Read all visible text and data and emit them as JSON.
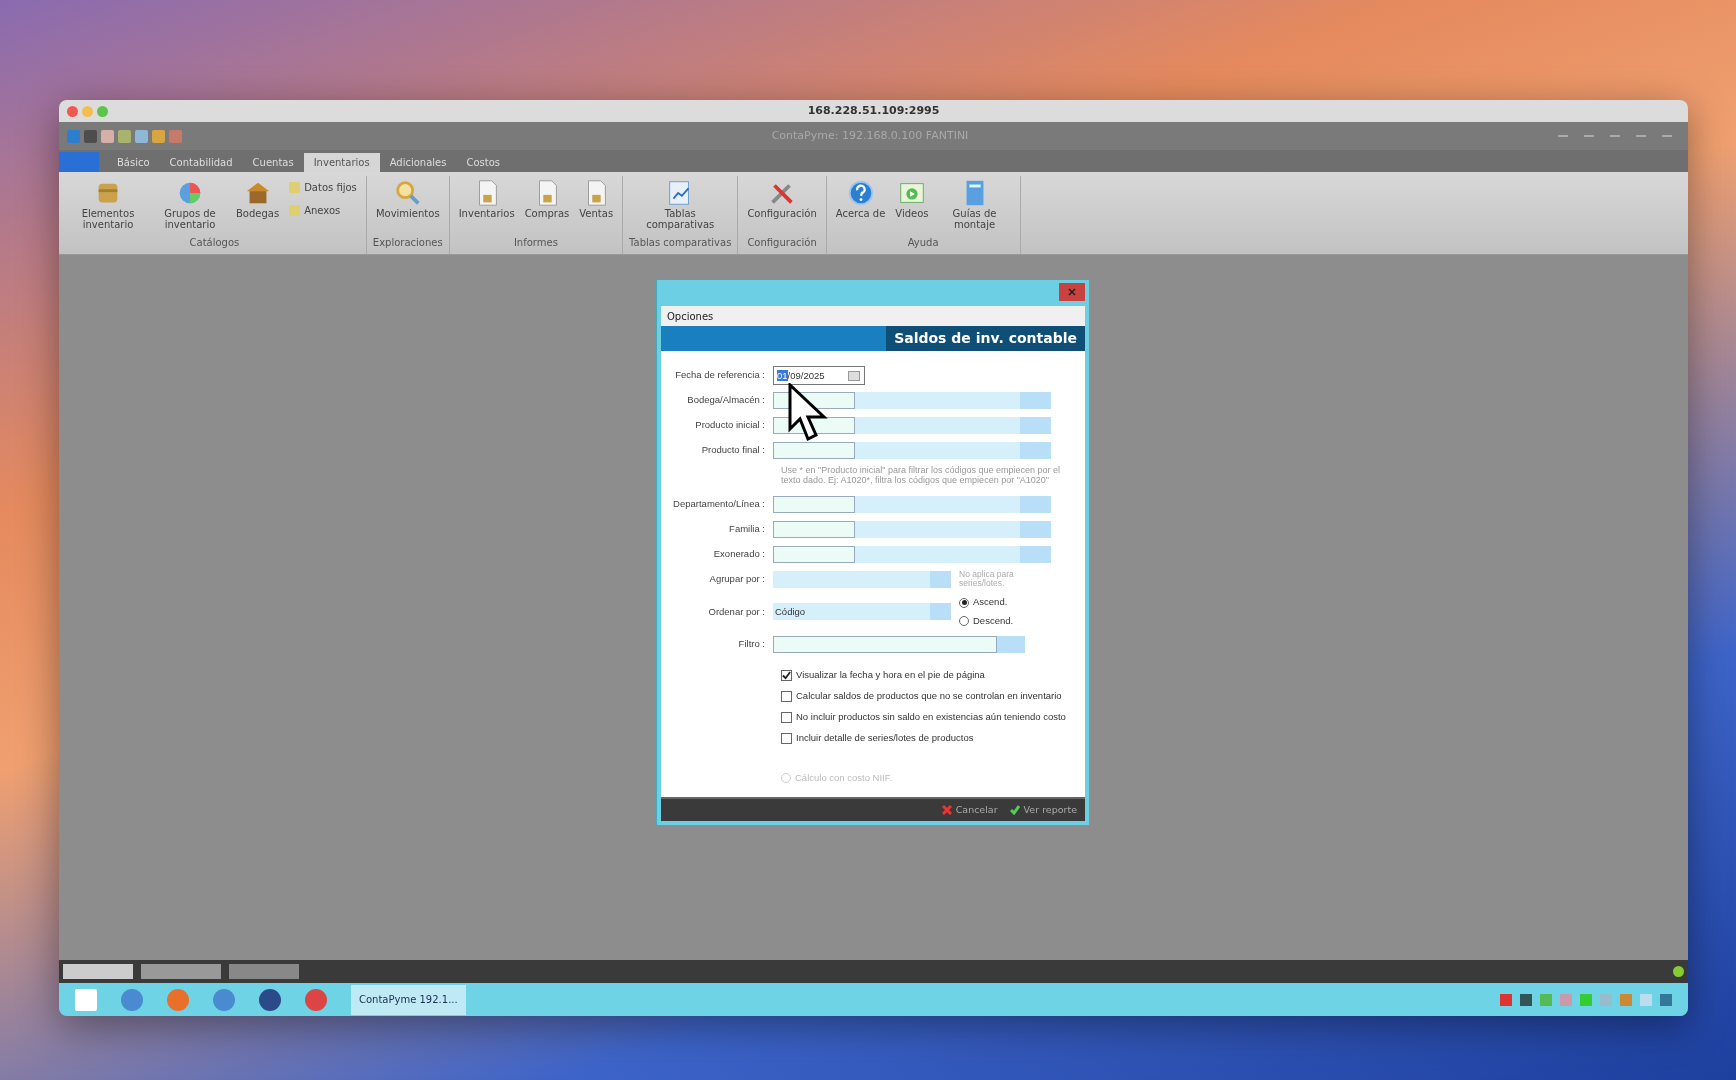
{
  "window": {
    "title": "168.228.51.109:2995",
    "app_title": "ContaPyme: 192.168.0.100 FANTINI"
  },
  "ribbon": {
    "tabs": [
      {
        "label": "Básico",
        "selected": false
      },
      {
        "label": "Contabilidad",
        "selected": false
      },
      {
        "label": "Cuentas",
        "selected": false
      },
      {
        "label": "Inventarios",
        "selected": true
      },
      {
        "label": "Adicionales",
        "selected": false
      },
      {
        "label": "Costos",
        "selected": false
      }
    ],
    "groups": [
      {
        "label": "Catálogos",
        "items": [
          {
            "label": "Elementos inventario",
            "kind": "box"
          },
          {
            "label": "Grupos de inventario",
            "kind": "pie"
          },
          {
            "label": "Bodegas",
            "kind": "house"
          },
          {
            "label": "Datos fijos",
            "kind": "small"
          },
          {
            "label": "Anexos",
            "kind": "small"
          }
        ]
      },
      {
        "label": "Exploraciones",
        "items": [
          {
            "label": "Movimientos",
            "kind": "search"
          }
        ]
      },
      {
        "label": "Informes",
        "items": [
          {
            "label": "Inventarios",
            "kind": "doc"
          },
          {
            "label": "Compras",
            "kind": "doc"
          },
          {
            "label": "Ventas",
            "kind": "doc"
          }
        ]
      },
      {
        "label": "Tablas comparativas",
        "items": [
          {
            "label": "Tablas comparativas",
            "kind": "chart"
          }
        ]
      },
      {
        "label": "Configuración",
        "items": [
          {
            "label": "Configuración",
            "kind": "tools"
          }
        ]
      },
      {
        "label": "Ayuda",
        "items": [
          {
            "label": "Acerca de",
            "kind": "help"
          },
          {
            "label": "Videos",
            "kind": "video"
          },
          {
            "label": "Guías de montaje",
            "kind": "guide"
          }
        ]
      }
    ]
  },
  "dialog": {
    "menu": "Opciones",
    "title": "Saldos de inv. contable",
    "fields": [
      {
        "kind": "date",
        "label": "Fecha de referencia :",
        "value": "01/09/2025"
      },
      {
        "kind": "lookup",
        "label": "Bodega/Almacén :"
      },
      {
        "kind": "lookup",
        "label": "Producto inicial :"
      },
      {
        "kind": "lookup",
        "label": "Producto final :"
      },
      {
        "kind": "hint",
        "text": "Use * en \"Producto inicial\" para filtrar los códigos que empiecen por el texto dado. Ej: A1020*, filtra los códigos que empiecen por \"A1020\""
      },
      {
        "kind": "lookup",
        "label": "Departamento/Línea :"
      },
      {
        "kind": "lookup",
        "label": "Familia :"
      },
      {
        "kind": "lookup",
        "label": "Exonerado :"
      },
      {
        "kind": "combo",
        "label": "Agrupar por :",
        "note": "No aplica para series/lotes."
      },
      {
        "kind": "combo",
        "label": "Ordenar por :",
        "value": "Código",
        "radios": [
          {
            "label": "Ascend.",
            "selected": true
          },
          {
            "label": "Descend.",
            "selected": false
          }
        ]
      },
      {
        "kind": "text",
        "label": "Filtro :"
      }
    ],
    "checkboxes": [
      {
        "label": "Visualizar la fecha y hora en el pie de página",
        "checked": true
      },
      {
        "label": "Calcular saldos de productos que no se controlan en inventario",
        "checked": false
      },
      {
        "label": "No incluir productos sin saldo en existencias aún teniendo costo",
        "checked": false
      },
      {
        "label": "Incluir detalle de series/lotes de productos",
        "checked": false
      }
    ],
    "option": {
      "label": "Cálculo con costo NIIF.",
      "disabled": true
    },
    "buttons": [
      {
        "label": "Cancelar",
        "kind": "cancel"
      },
      {
        "label": "Ver reporte",
        "kind": "ok"
      }
    ]
  },
  "taskbar": {
    "apps": [
      {
        "kind": "windows"
      },
      {
        "kind": "app"
      },
      {
        "kind": "firefox"
      },
      {
        "kind": "app"
      },
      {
        "kind": "compass"
      },
      {
        "kind": "chrome"
      }
    ],
    "window_button": "ContaPyme 192.1..."
  }
}
